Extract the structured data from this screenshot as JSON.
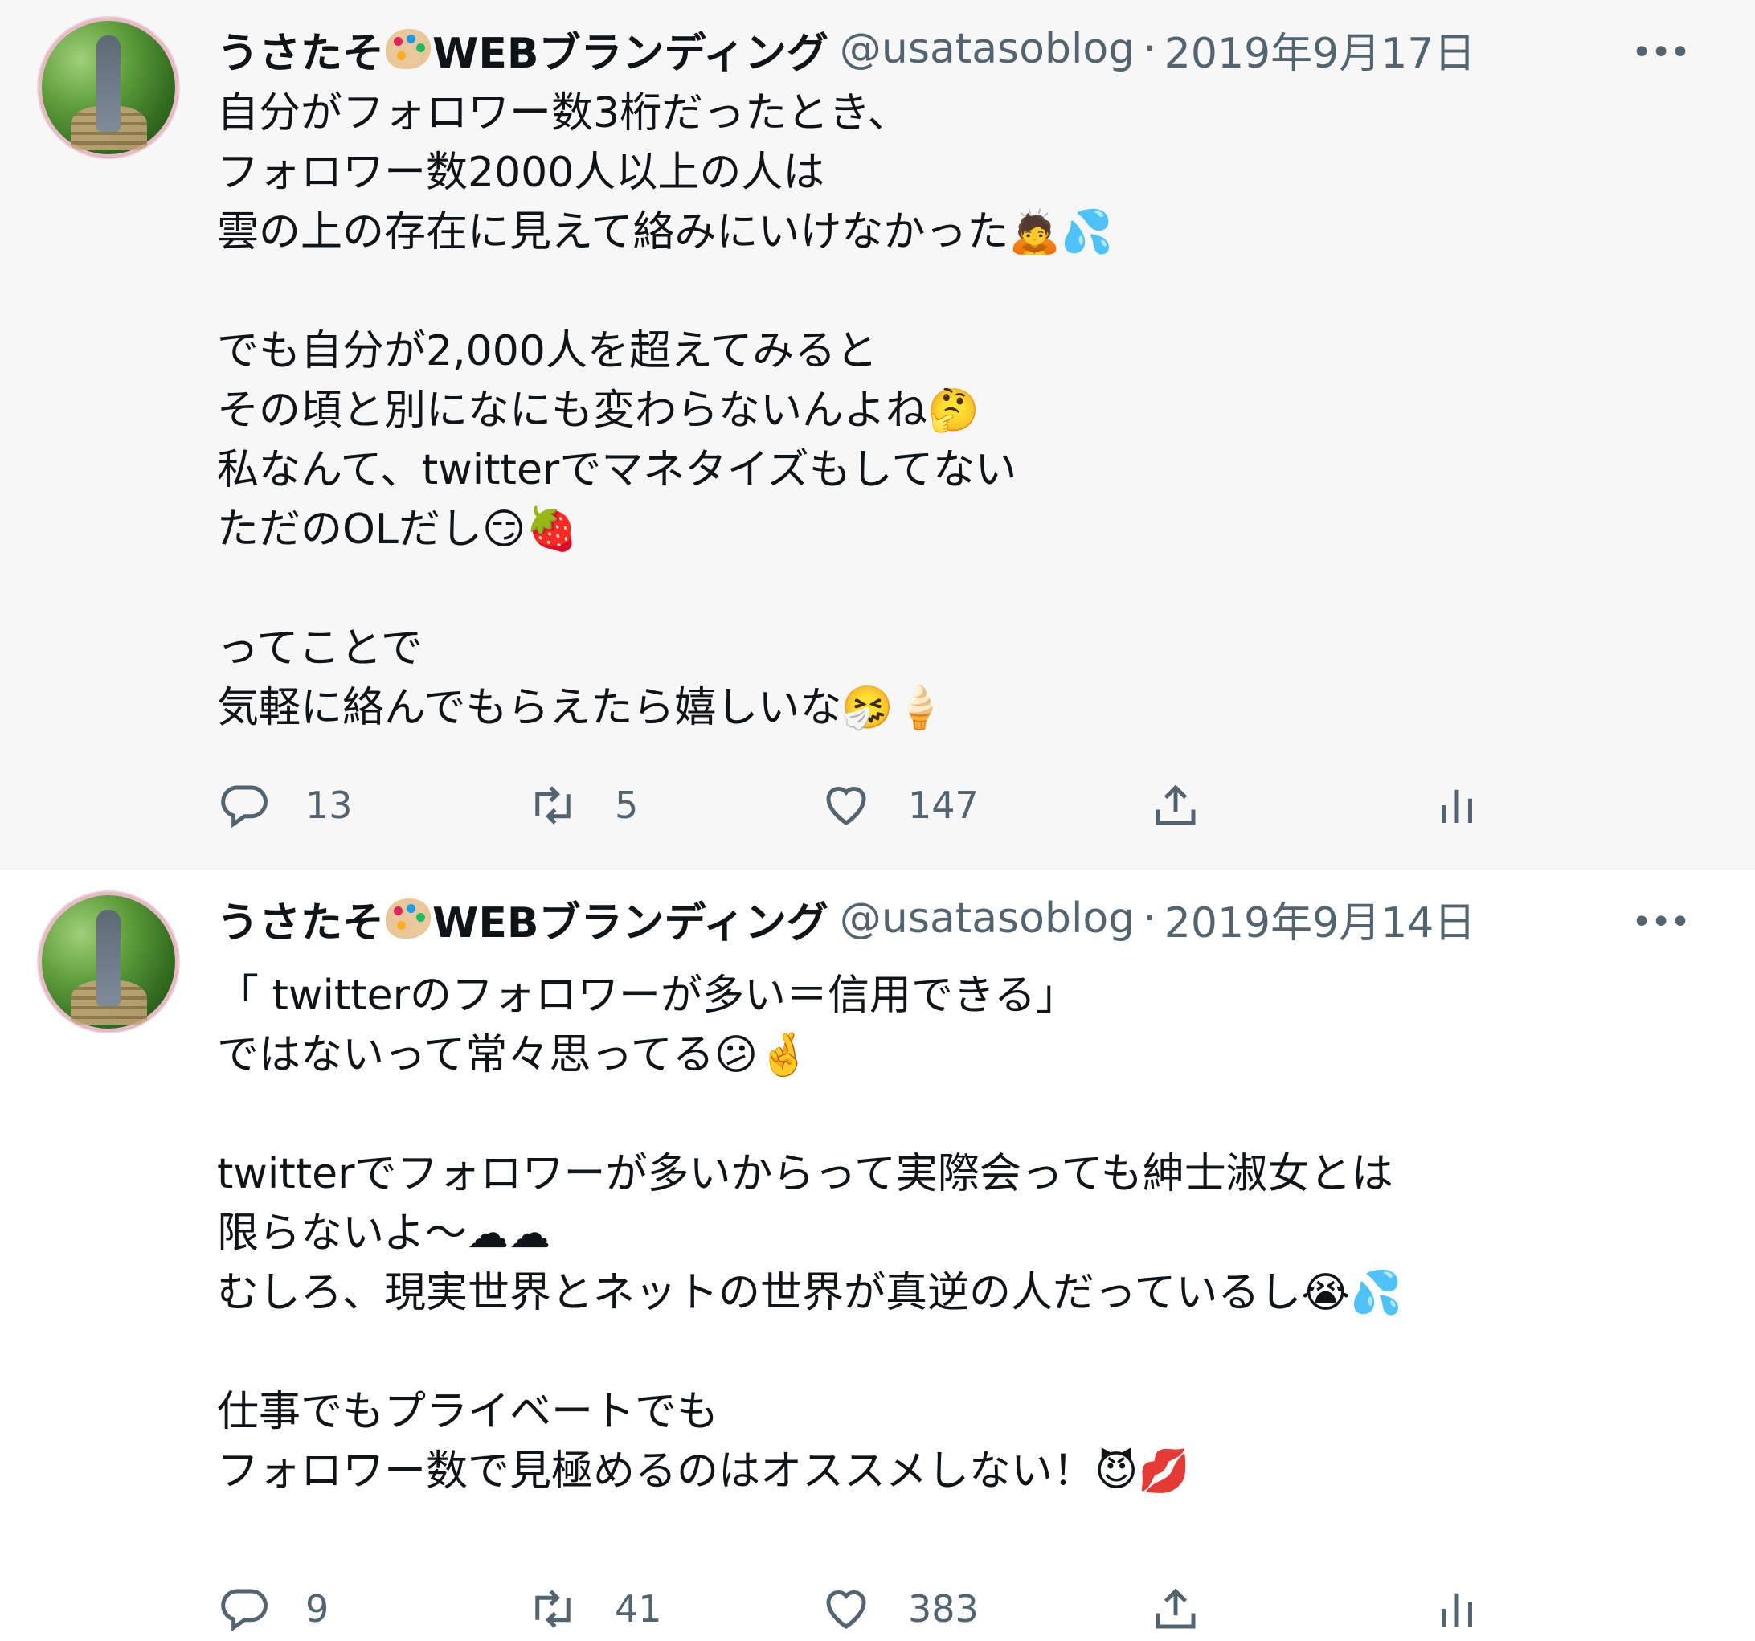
{
  "colors": {
    "accent": "#1d9bf0",
    "secondary_text": "#536471",
    "primary_text": "#0f1419",
    "tweet1_bg": "#f7f7f7"
  },
  "tweets": [
    {
      "author_name": "うさたそ",
      "author_suffix": "WEBブランディング",
      "name_emoji": "artist-palette",
      "handle": "@usatasoblog",
      "separator": "·",
      "date": "2019年9月17日",
      "more": "•••",
      "text": "自分がフォロワー数3桁だったとき、\nフォロワー数2000人以上の人は\n雲の上の存在に見えて絡みにいけなかった🙇💦\n\nでも自分が2,000人を超えてみると\nその頃と別になにも変わらないんよね🤔\n私なんて、twitterでマネタイズもしてない\nただのOLだし😏🍓\n\nってことで\n気軽に絡んでもらえたら嬉しいな🤧🍦",
      "stats": {
        "replies": "13",
        "retweets": "5",
        "likes": "147"
      }
    },
    {
      "author_name": "うさたそ",
      "author_suffix": "WEBブランディング",
      "name_emoji": "artist-palette",
      "handle": "@usatasoblog",
      "separator": "·",
      "date": "2019年9月14日",
      "more": "•••",
      "text": "「 twitterのフォロワーが多い＝信用できる」\nではないって常々思ってる😕🤞\n\ntwitterでフォロワーが多いからって実際会っても紳士淑女とは\n限らないよ〜☁☁\nむしろ、現実世界とネットの世界が真逆の人だっているし😭💦\n\n仕事でもプライベートでも\nフォロワー数で見極めるのはオススメしない！😈💋",
      "stats": {
        "replies": "9",
        "retweets": "41",
        "likes": "383"
      }
    }
  ],
  "icons": {
    "reply": "reply-icon",
    "retweet": "retweet-icon",
    "like": "heart-icon",
    "share": "share-icon",
    "analytics": "analytics-icon"
  }
}
